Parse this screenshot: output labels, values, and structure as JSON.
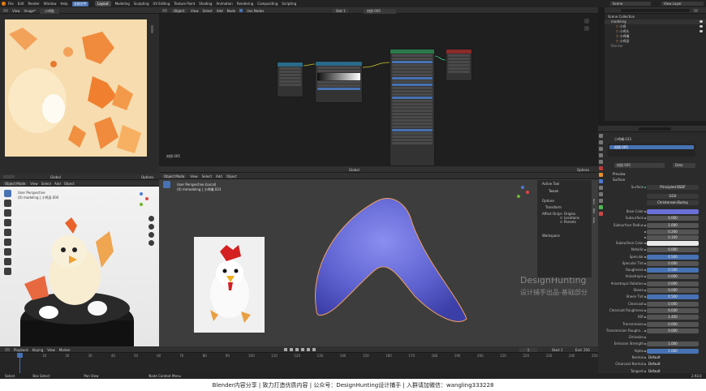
{
  "topbar": {
    "menus": [
      "File",
      "Edit",
      "Render",
      "Window",
      "Help"
    ],
    "active_menu_badge": "当前文件",
    "workspaces": [
      "Layout",
      "Modeling",
      "Sculpting",
      "UV Editing",
      "Texture Paint",
      "Shading",
      "Animation",
      "Rendering",
      "Compositing",
      "Scripting"
    ],
    "active_workspace": "Layout",
    "scene_label": "Scene",
    "view_layer_label": "View Layer"
  },
  "image_editor": {
    "view": "View",
    "image": "Image*",
    "image_name": "小鸡贴"
  },
  "node_editor": {
    "object": "Object",
    "view": "View",
    "select": "Select",
    "add": "Add",
    "node": "Node",
    "use_nodes": "Use Nodes",
    "slot": "Slot 1",
    "material": "材质.005",
    "footer_label": "材质.005"
  },
  "left_viewport": {
    "mode": "Object Mode",
    "view": "View",
    "select": "Select",
    "add": "Add",
    "object": "Object",
    "perspective": "User Perspective",
    "collection": "(0) modeling | 小鸡身.000",
    "global": "Global",
    "options": "Options"
  },
  "main_viewport": {
    "mode": "Object Mode",
    "view": "View",
    "select": "Select",
    "add": "Add",
    "object": "Object",
    "perspective": "User Perspective (Local)",
    "collection": "(0) mmodeling | 小鸡嘴.033",
    "global": "Global",
    "options": "Options",
    "watermark_en": "DesignHunting",
    "watermark_cn": "设计捕手出品-基础部分"
  },
  "n_panel": {
    "active_tool": "Active Tool",
    "tweak": "Tweak",
    "options": "Options",
    "transform": "Transform",
    "affect_only": "Affect Only",
    "origins": "Origins",
    "locations": "Locations",
    "parents": "Parents",
    "workspace": "Workspace",
    "tabs": [
      "Item",
      "Tool",
      "View"
    ]
  },
  "outliner": {
    "title": "Scene Collection",
    "items": [
      "modeling",
      "小鸡",
      "小鸡头",
      "小鸡嘴",
      "小鸡身",
      "Blocker"
    ]
  },
  "properties": {
    "object_name": "小鸡嘴.033",
    "material_slot": "材质.005",
    "material_name": "材质.005",
    "data": "Data",
    "preview": "Preview",
    "surface_section": "Surface",
    "surface_shader": "Principled BSDF",
    "distribution": "GGX",
    "subsurface_method": "Christensen-Burley",
    "rows": [
      {
        "label": "Base Color",
        "value": "",
        "kind": "blue"
      },
      {
        "label": "Subsurface",
        "value": "0.000",
        "kind": "grey"
      },
      {
        "label": "Subsurface Radius",
        "value": "1.000",
        "kind": "grey"
      },
      {
        "label": "",
        "value": "0.200",
        "kind": "grey"
      },
      {
        "label": "",
        "value": "0.100",
        "kind": "grey"
      },
      {
        "label": "Subsurface Color",
        "value": "",
        "kind": "white"
      },
      {
        "label": "Metallic",
        "value": "0.000",
        "kind": "grey"
      },
      {
        "label": "Specular",
        "value": "0.500",
        "kind": "blue"
      },
      {
        "label": "Specular Tint",
        "value": "0.000",
        "kind": "grey"
      },
      {
        "label": "Roughness",
        "value": "0.500",
        "kind": "blue"
      },
      {
        "label": "Anisotropic",
        "value": "0.000",
        "kind": "grey"
      },
      {
        "label": "Anisotropic Rotation",
        "value": "0.000",
        "kind": "grey"
      },
      {
        "label": "Sheen",
        "value": "0.000",
        "kind": "grey"
      },
      {
        "label": "Sheen Tint",
        "value": "0.500",
        "kind": "blue"
      },
      {
        "label": "Clearcoat",
        "value": "0.000",
        "kind": "grey"
      },
      {
        "label": "Clearcoat Roughness",
        "value": "0.030",
        "kind": "grey"
      },
      {
        "label": "IOR",
        "value": "1.450",
        "kind": "grey"
      },
      {
        "label": "Transmission",
        "value": "0.000",
        "kind": "grey"
      },
      {
        "label": "Transmission Roughn...",
        "value": "0.000",
        "kind": "grey"
      },
      {
        "label": "Emission",
        "value": "",
        "kind": "dark"
      },
      {
        "label": "Emission Strength",
        "value": "1.000",
        "kind": "grey"
      },
      {
        "label": "Alpha",
        "value": "1.000",
        "kind": "blue"
      },
      {
        "label": "Normal",
        "value": "Default",
        "kind": "none"
      },
      {
        "label": "Clearcoat Normal",
        "value": "Default",
        "kind": "none"
      },
      {
        "label": "Tangent",
        "value": "Default",
        "kind": "none"
      }
    ]
  },
  "timeline": {
    "playback": "Playback",
    "keying": "Keying",
    "view": "View",
    "marker": "Marker",
    "current_frame": "1",
    "start_label": "Start",
    "start": "1",
    "end_label": "End",
    "end": "250",
    "ticks": [
      "0",
      "10",
      "20",
      "30",
      "40",
      "50",
      "60",
      "70",
      "80",
      "90",
      "100",
      "110",
      "120",
      "130",
      "140",
      "150",
      "160",
      "170",
      "180",
      "190",
      "200",
      "210",
      "220",
      "230",
      "240",
      "250"
    ]
  },
  "statusbar": {
    "select": "Select",
    "box_select": "Box Select",
    "pan_view": "Pan View",
    "context_menu": "Node Context Menu",
    "version": "2.93.0"
  },
  "caption": {
    "text": "Blender内容分享  |  致力打造优质内容  |  公众号：DesignHunting设计捕手  |  入群请加微信：wangling333228"
  },
  "colors": {
    "accent": "#4772b3",
    "mesh": "#6b6fd8",
    "outline": "#f0a060",
    "bsdf_header": "#2a7a4a",
    "output_header": "#8a2a2a",
    "texture_header": "#2a6a8a"
  }
}
